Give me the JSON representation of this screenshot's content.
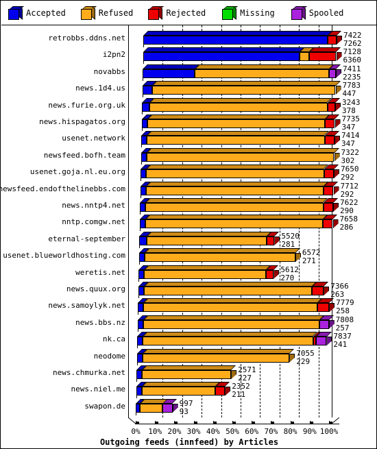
{
  "legend": {
    "items": [
      {
        "label": "Accepted",
        "color": "#0000ee",
        "icon": "cube-icon"
      },
      {
        "label": "Refused",
        "color": "#ffac1c",
        "icon": "cube-icon"
      },
      {
        "label": "Rejected",
        "color": "#ee0000",
        "icon": "cube-icon"
      },
      {
        "label": "Missing",
        "color": "#00dd00",
        "icon": "cube-icon"
      },
      {
        "label": "Spooled",
        "color": "#aa22dd",
        "icon": "cube-icon"
      }
    ]
  },
  "chart_data": {
    "type": "bar",
    "orientation": "horizontal",
    "stacked": true,
    "percent_stacked": true,
    "title": "Outgoing feeds (innfeed) by Articles",
    "xlabel": "Outgoing feeds (innfeed) by Articles",
    "ylabel": "",
    "xlim": [
      0,
      100
    ],
    "xticks": [
      0,
      10,
      20,
      30,
      40,
      50,
      60,
      70,
      80,
      90,
      100
    ],
    "xticklabels": [
      "0%",
      "10%",
      "20%",
      "30%",
      "40%",
      "50%",
      "60%",
      "70%",
      "80%",
      "90%",
      "100%"
    ],
    "grid": "vertical-dashed",
    "legend_position": "top",
    "series_names": [
      "Accepted",
      "Refused",
      "Rejected",
      "Missing",
      "Spooled"
    ],
    "series_colors": [
      "#0000ee",
      "#ffac1c",
      "#ee0000",
      "#00dd00",
      "#aa22dd"
    ],
    "categories": [
      "retrobbs.ddns.net",
      "i2pn2",
      "novabbs",
      "news.1d4.us",
      "news.furie.org.uk",
      "news.hispagatos.org",
      "usenet.network",
      "newsfeed.bofh.team",
      "usenet.goja.nl.eu.org",
      "newsfeed.endofthelinebbs.com",
      "news.nntp4.net",
      "nntp.comgw.net",
      "eternal-september",
      "usenet.blueworldhosting.com",
      "weretis.net",
      "news.quux.org",
      "news.samoylyk.net",
      "news.bbs.nz",
      "nk.ca",
      "neodome",
      "news.chmurka.net",
      "news.niel.me",
      "swapon.de"
    ],
    "rows": [
      {
        "label": "retrobbs.ddns.net",
        "offered": 7422,
        "accepted": 7262,
        "pct": {
          "Accepted": 95.5,
          "Refused": 0.0,
          "Rejected": 4.5,
          "Missing": 0.0,
          "Spooled": 0.0
        }
      },
      {
        "label": "i2pn2",
        "offered": 7128,
        "accepted": 6360,
        "pct": {
          "Accepted": 81.0,
          "Refused": 5.0,
          "Rejected": 14.0,
          "Missing": 0.0,
          "Spooled": 0.0
        }
      },
      {
        "label": "novabbs",
        "offered": 7411,
        "accepted": 2235,
        "pct": {
          "Accepted": 27.0,
          "Refused": 69.5,
          "Rejected": 0.0,
          "Missing": 0.0,
          "Spooled": 3.5
        }
      },
      {
        "label": "news.1d4.us",
        "offered": 7783,
        "accepted": 447,
        "pct": {
          "Accepted": 5.0,
          "Refused": 95.0,
          "Rejected": 0.0,
          "Missing": 0.0,
          "Spooled": 0.0
        }
      },
      {
        "label": "news.furie.org.uk",
        "offered": 3243,
        "accepted": 378,
        "pct": {
          "Accepted": 4.0,
          "Refused": 92.0,
          "Rejected": 4.0,
          "Missing": 0.0,
          "Spooled": 0.0
        }
      },
      {
        "label": "news.hispagatos.org",
        "offered": 7735,
        "accepted": 347,
        "pct": {
          "Accepted": 3.0,
          "Refused": 92.0,
          "Rejected": 5.0,
          "Missing": 0.0,
          "Spooled": 0.0
        }
      },
      {
        "label": "usenet.network",
        "offered": 7414,
        "accepted": 347,
        "pct": {
          "Accepted": 3.0,
          "Refused": 92.0,
          "Rejected": 5.0,
          "Missing": 0.0,
          "Spooled": 0.0
        }
      },
      {
        "label": "newsfeed.bofh.team",
        "offered": 7322,
        "accepted": 302,
        "pct": {
          "Accepted": 3.0,
          "Refused": 97.0,
          "Rejected": 0.0,
          "Missing": 0.0,
          "Spooled": 0.0
        }
      },
      {
        "label": "usenet.goja.nl.eu.org",
        "offered": 7650,
        "accepted": 292,
        "pct": {
          "Accepted": 3.0,
          "Refused": 92.0,
          "Rejected": 5.0,
          "Missing": 0.0,
          "Spooled": 0.0
        }
      },
      {
        "label": "newsfeed.endofthelinebbs.com",
        "offered": 7712,
        "accepted": 292,
        "pct": {
          "Accepted": 3.0,
          "Refused": 92.0,
          "Rejected": 5.0,
          "Missing": 0.0,
          "Spooled": 0.0
        }
      },
      {
        "label": "news.nntp4.net",
        "offered": 7622,
        "accepted": 290,
        "pct": {
          "Accepted": 3.0,
          "Refused": 92.0,
          "Rejected": 5.0,
          "Missing": 0.0,
          "Spooled": 0.0
        }
      },
      {
        "label": "nntp.comgw.net",
        "offered": 7658,
        "accepted": 286,
        "pct": {
          "Accepted": 3.0,
          "Refused": 92.0,
          "Rejected": 5.0,
          "Missing": 0.0,
          "Spooled": 0.0
        }
      },
      {
        "label": "eternal-september",
        "offered": 5520,
        "accepted": 281,
        "pct": {
          "Accepted": 4.0,
          "Refused": 62.0,
          "Rejected": 4.0,
          "Missing": 0.0,
          "Spooled": 0.0
        }
      },
      {
        "label": "usenet.blueworldhosting.com",
        "offered": 6572,
        "accepted": 271,
        "pct": {
          "Accepted": 3.0,
          "Refused": 78.0,
          "Rejected": 0.0,
          "Missing": 0.0,
          "Spooled": 0.0
        }
      },
      {
        "label": "weretis.net",
        "offered": 5612,
        "accepted": 270,
        "pct": {
          "Accepted": 3.0,
          "Refused": 63.0,
          "Rejected": 4.0,
          "Missing": 0.0,
          "Spooled": 0.0
        }
      },
      {
        "label": "news.quux.org",
        "offered": 7366,
        "accepted": 263,
        "pct": {
          "Accepted": 3.0,
          "Refused": 87.0,
          "Rejected": 6.0,
          "Missing": 0.0,
          "Spooled": 0.0
        }
      },
      {
        "label": "news.samoylyk.net",
        "offered": 7779,
        "accepted": 258,
        "pct": {
          "Accepted": 3.0,
          "Refused": 90.0,
          "Rejected": 6.0,
          "Missing": 0.0,
          "Spooled": 0.0
        }
      },
      {
        "label": "news.bbs.nz",
        "offered": 7808,
        "accepted": 257,
        "pct": {
          "Accepted": 3.0,
          "Refused": 91.0,
          "Rejected": 0.0,
          "Missing": 0.0,
          "Spooled": 5.0
        }
      },
      {
        "label": "nk.ca",
        "offered": 7837,
        "accepted": 241,
        "pct": {
          "Accepted": 3.0,
          "Refused": 88.0,
          "Rejected": 1.5,
          "Missing": 0.0,
          "Spooled": 5.5
        }
      },
      {
        "label": "neodome",
        "offered": 7055,
        "accepted": 229,
        "pct": {
          "Accepted": 3.0,
          "Refused": 76.0,
          "Rejected": 0.0,
          "Missing": 0.0,
          "Spooled": 0.0
        }
      },
      {
        "label": "news.chmurka.net",
        "offered": 2571,
        "accepted": 227,
        "pct": {
          "Accepted": 3.0,
          "Refused": 46.0,
          "Rejected": 0.0,
          "Missing": 0.0,
          "Spooled": 0.0
        }
      },
      {
        "label": "news.niel.me",
        "offered": 2352,
        "accepted": 211,
        "pct": {
          "Accepted": 3.0,
          "Refused": 38.0,
          "Rejected": 5.0,
          "Missing": 0.0,
          "Spooled": 0.0
        }
      },
      {
        "label": "swapon.de",
        "offered": 997,
        "accepted": 93,
        "pct": {
          "Accepted": 2.0,
          "Refused": 12.0,
          "Rejected": 0.0,
          "Missing": 0.0,
          "Spooled": 5.0
        }
      }
    ]
  }
}
